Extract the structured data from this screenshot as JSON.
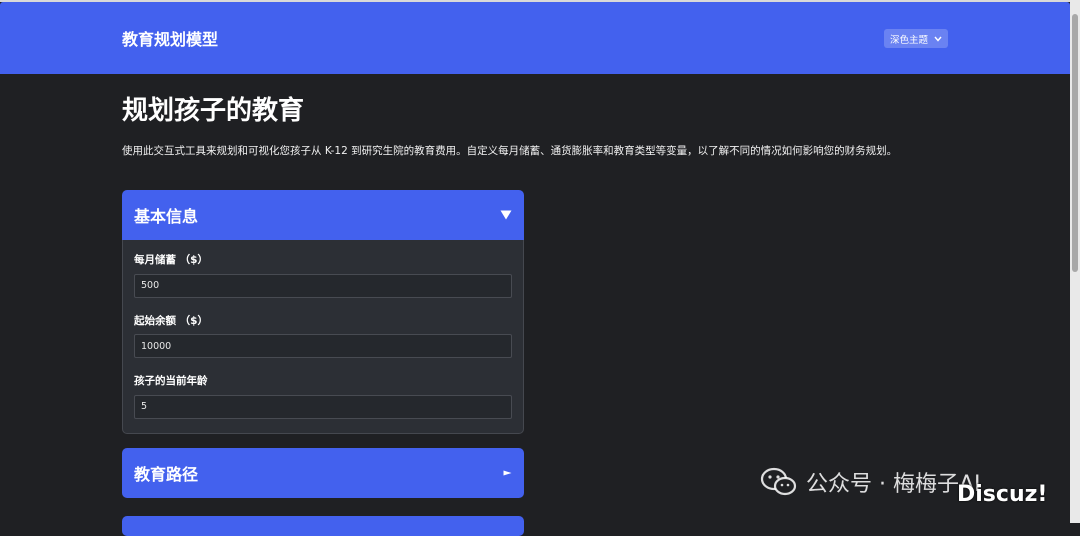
{
  "header": {
    "app_title": "教育规划模型",
    "theme_select": {
      "selected": "深色主题"
    }
  },
  "main": {
    "page_title": "规划孩子的教育",
    "intro": "使用此交互式工具来规划和可视化您孩子从 K-12 到研究生院的教育费用。自定义每月储蓄、通货膨胀率和教育类型等变量，以了解不同的情况如何影响您的财务规划。"
  },
  "panels": [
    {
      "title": "基本信息",
      "expanded": true,
      "toggle_icon": "triangle-down-icon",
      "fields": [
        {
          "label": "每月储蓄 （$）",
          "value": "500"
        },
        {
          "label": "起始余额 （$）",
          "value": "10000"
        },
        {
          "label": "孩子的当前年龄",
          "value": "5"
        }
      ]
    },
    {
      "title": "教育路径",
      "expanded": false,
      "toggle_icon": "triangle-right-icon"
    }
  ],
  "watermark": {
    "text": "公众号 · 梅梅子AI",
    "badge": "Discuz!",
    "icon": "wechat-icon"
  },
  "colors": {
    "accent": "#4361ee",
    "background": "#1f2023",
    "panel_body": "#2c2f35"
  }
}
